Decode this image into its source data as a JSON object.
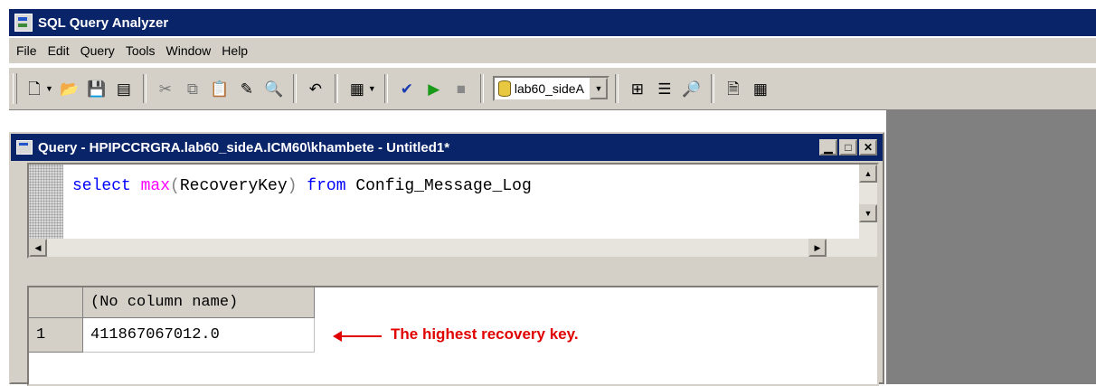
{
  "app": {
    "title": "SQL Query Analyzer"
  },
  "menu": [
    "File",
    "Edit",
    "Query",
    "Tools",
    "Window",
    "Help"
  ],
  "toolbar": {
    "database": "lab60_sideA"
  },
  "query_window": {
    "title": "Query - HPIPCCRGRA.lab60_sideA.ICM60\\khambete - Untitled1*",
    "code": {
      "kw_select": "select",
      "fn_max": "max",
      "paren_open": "(",
      "column": "RecoveryKey",
      "paren_close": ")",
      "kw_from": "from",
      "table": "Config_Message_Log"
    }
  },
  "results": {
    "column_header": "(No column name)",
    "row_number": "1",
    "value": "411867067012.0"
  },
  "annotation": {
    "text": "The highest recovery key.",
    "color": "#e00000"
  },
  "colors": {
    "titlebar": "#0a246a",
    "chrome": "#d4d0c8",
    "workspace": "#808080"
  }
}
